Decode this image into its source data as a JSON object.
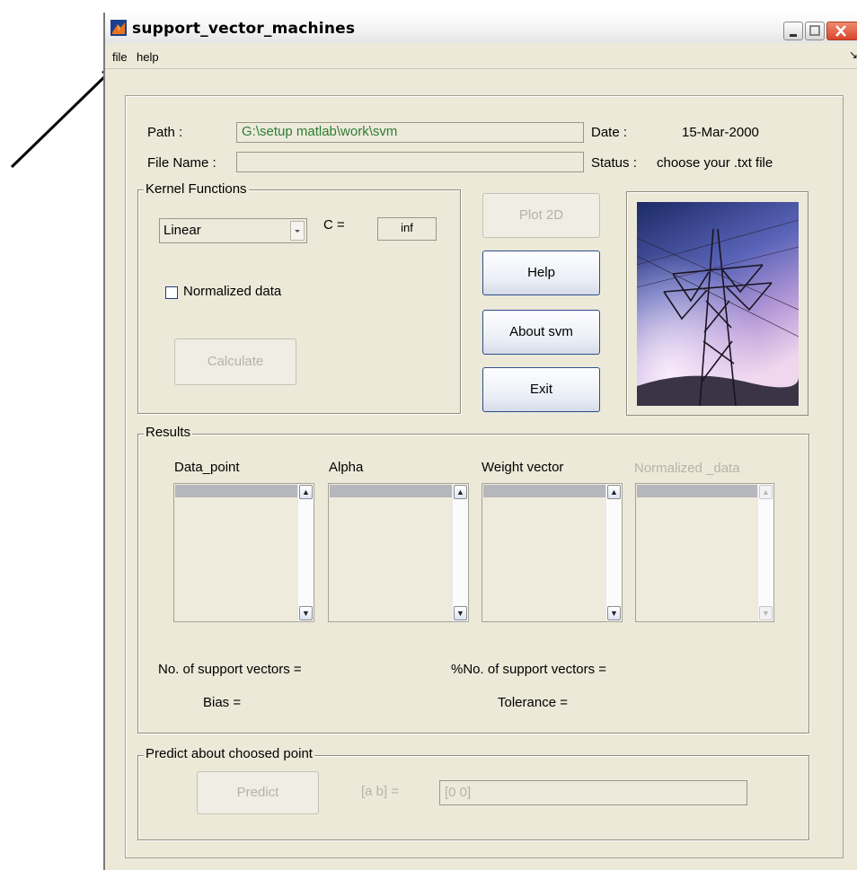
{
  "window": {
    "title": "support_vector_machines"
  },
  "menubar": {
    "items": [
      "file",
      "help"
    ]
  },
  "path": {
    "label": "Path :",
    "value": "G:\\setup matlab\\work\\svm"
  },
  "date": {
    "label": "Date :",
    "value": "15-Mar-2000"
  },
  "filename": {
    "label": "File Name :",
    "value": ""
  },
  "status": {
    "label": "Status :",
    "value": "choose your .txt file"
  },
  "kernel": {
    "group_title": "Kernel Functions",
    "selected": "Linear",
    "c_label": "C =",
    "c_value": "inf",
    "normalized_label": "Normalized data",
    "normalized_checked": false,
    "calculate_label": "Calculate"
  },
  "buttons": {
    "plot2d": "Plot 2D",
    "help": "Help",
    "about": "About svm",
    "exit": "Exit"
  },
  "results": {
    "group_title": "Results",
    "columns": [
      "Data_point",
      "Alpha",
      "Weight vector",
      "Normalized _data"
    ],
    "support_vectors_label": "No. of support vectors =",
    "percent_support_label": "%No. of support vectors =",
    "bias_label": "Bias =",
    "tolerance_label": "Tolerance ="
  },
  "predict": {
    "group_title": "Predict about choosed point",
    "button_label": "Predict",
    "ab_label": "[a   b]  =",
    "ab_value": "[0 0]"
  },
  "colors": {
    "path_text": "#2e7d32",
    "disabled_text": "#b5b3a8",
    "window_bg": "#ece9d8",
    "close_button": "#d9452b"
  },
  "icons": [
    "matlab-logo-icon",
    "minimize-icon",
    "maximize-icon",
    "close-icon",
    "annotation-arrow-icon",
    "chevron-up-icon",
    "chevron-down-icon"
  ]
}
